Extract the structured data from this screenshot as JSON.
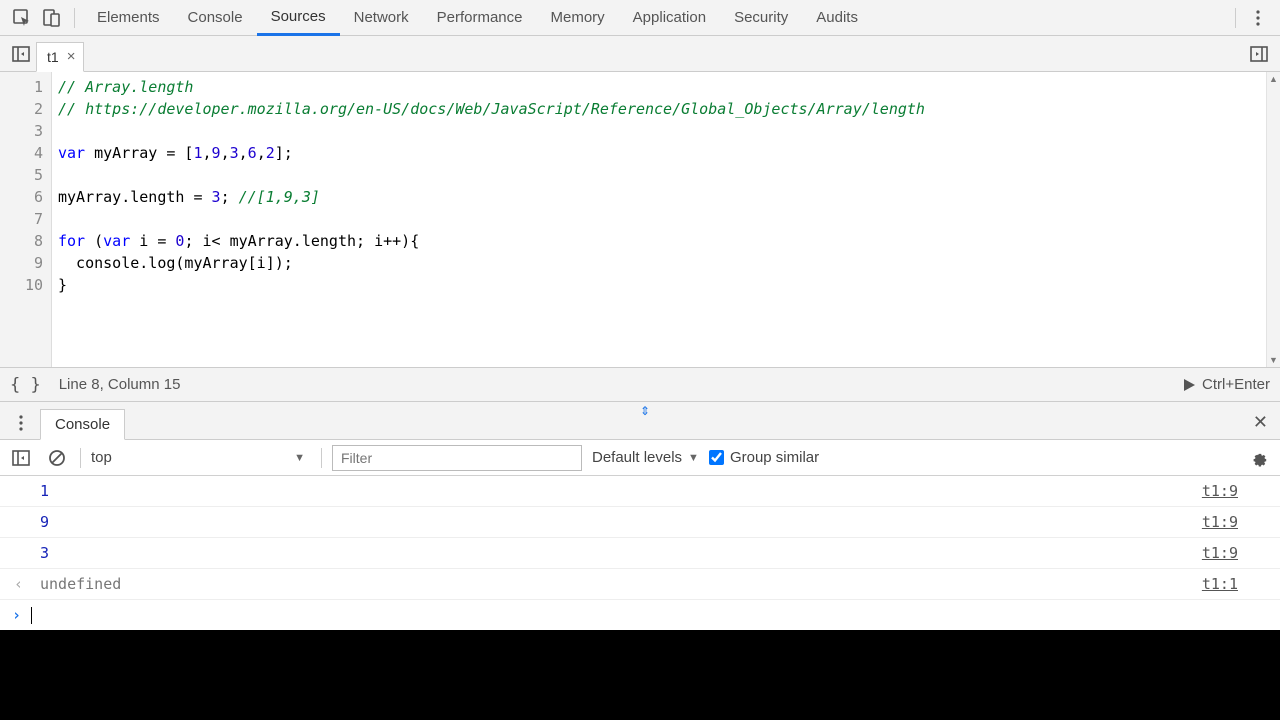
{
  "panels": {
    "tabs": [
      "Elements",
      "Console",
      "Sources",
      "Network",
      "Performance",
      "Memory",
      "Application",
      "Security",
      "Audits"
    ],
    "active": "Sources"
  },
  "file": {
    "name": "t1"
  },
  "editor": {
    "line_count": 10,
    "lines": [
      [
        {
          "t": "// Array.length",
          "c": "tok-comment"
        }
      ],
      [
        {
          "t": "// https://developer.mozilla.org/en-US/docs/Web/JavaScript/Reference/Global_Objects/Array/length",
          "c": "tok-comment"
        }
      ],
      [
        {
          "t": "",
          "c": ""
        }
      ],
      [
        {
          "t": "var",
          "c": "tok-kw2"
        },
        {
          "t": " myArray = [",
          "c": ""
        },
        {
          "t": "1",
          "c": "tok-num"
        },
        {
          "t": ",",
          "c": ""
        },
        {
          "t": "9",
          "c": "tok-num"
        },
        {
          "t": ",",
          "c": ""
        },
        {
          "t": "3",
          "c": "tok-num"
        },
        {
          "t": ",",
          "c": ""
        },
        {
          "t": "6",
          "c": "tok-num"
        },
        {
          "t": ",",
          "c": ""
        },
        {
          "t": "2",
          "c": "tok-num"
        },
        {
          "t": "];",
          "c": ""
        }
      ],
      [
        {
          "t": "",
          "c": ""
        }
      ],
      [
        {
          "t": "myArray.length = ",
          "c": ""
        },
        {
          "t": "3",
          "c": "tok-num"
        },
        {
          "t": "; ",
          "c": ""
        },
        {
          "t": "//[1,9,3]",
          "c": "tok-comment"
        }
      ],
      [
        {
          "t": "",
          "c": ""
        }
      ],
      [
        {
          "t": "for",
          "c": "tok-kw2"
        },
        {
          "t": " (",
          "c": ""
        },
        {
          "t": "var",
          "c": "tok-kw2"
        },
        {
          "t": " i = ",
          "c": ""
        },
        {
          "t": "0",
          "c": "tok-num"
        },
        {
          "t": "; i< myArray.length; i++){",
          "c": ""
        }
      ],
      [
        {
          "t": "  console.log(myArray[i]);",
          "c": ""
        }
      ],
      [
        {
          "t": "}",
          "c": ""
        }
      ]
    ]
  },
  "status": {
    "cursor": "Line 8, Column 15",
    "run_hint": "Ctrl+Enter"
  },
  "drawer": {
    "tab": "Console"
  },
  "console_toolbar": {
    "context": "top",
    "filter_placeholder": "Filter",
    "levels": "Default levels",
    "group_label": "Group similar",
    "group_checked": true
  },
  "console_output": [
    {
      "value": "1",
      "type": "num",
      "source": "t1:9"
    },
    {
      "value": "9",
      "type": "num",
      "source": "t1:9"
    },
    {
      "value": "3",
      "type": "num",
      "source": "t1:9"
    },
    {
      "value": "undefined",
      "type": "undef",
      "source": "t1:1"
    }
  ]
}
